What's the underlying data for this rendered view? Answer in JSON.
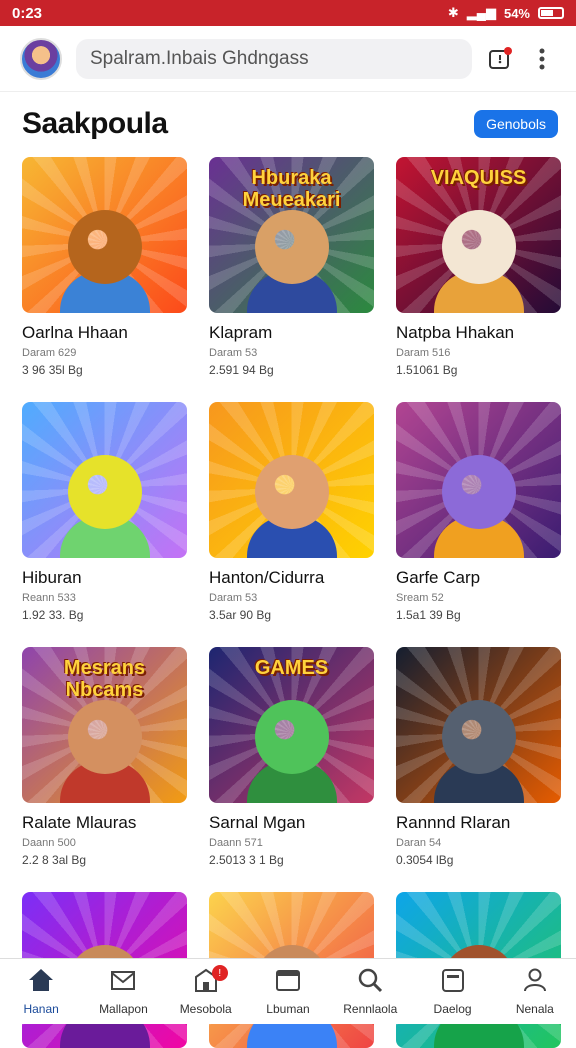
{
  "status": {
    "time": "0:23",
    "battery": "54%"
  },
  "header": {
    "search_placeholder": "Spalram.Inbais Ghdngass"
  },
  "section": {
    "title": "Saakpoula",
    "action_label": "Genobols"
  },
  "games": [
    {
      "name": "Oarlna Hhaan",
      "meta": "Daram 629",
      "size": "3 96 35l Bg",
      "banner": "",
      "colors": [
        "#f7b733",
        "#fc4a1a"
      ],
      "char": "#b5651d",
      "body": "#3b82d6"
    },
    {
      "name": "Klapram",
      "meta": "Daram 53",
      "size": "2.591 94 Bg",
      "banner": "Hburaka Meueakari",
      "colors": [
        "#6a3093",
        "#2b8a3e"
      ],
      "char": "#d9a066",
      "body": "#2e4a9e"
    },
    {
      "name": "Natpba Hhakan",
      "meta": "Daram 516",
      "size": "1.51061 Bg",
      "banner": "VIAQUISS",
      "colors": [
        "#c31432",
        "#240b36"
      ],
      "char": "#f3e6d3",
      "body": "#e8a23a"
    },
    {
      "name": "Hiburan",
      "meta": "Reann 533",
      "size": "1.92 33. Bg",
      "banner": "",
      "colors": [
        "#4facfe",
        "#c471f5"
      ],
      "char": "#e6e22a",
      "body": "#6fd36f"
    },
    {
      "name": "Hanton/Cidurra",
      "meta": "Daram 53",
      "size": "3.5ar 90 Bg",
      "banner": "",
      "colors": [
        "#f7971e",
        "#ffd200"
      ],
      "char": "#e0a070",
      "body": "#2a4fb0"
    },
    {
      "name": "Garfe Carp",
      "meta": "Sream 52",
      "size": "1.5a1 39 Bg",
      "banner": "",
      "colors": [
        "#b24592",
        "#3a1c71"
      ],
      "char": "#8c6ad8",
      "body": "#f0a020"
    },
    {
      "name": "Ralate Mlauras",
      "meta": "Daann 500",
      "size": "2.2 8 3al Bg",
      "banner": "Mesrans Nbcams",
      "colors": [
        "#8e44ad",
        "#f39c12"
      ],
      "char": "#d49060",
      "body": "#c0392b"
    },
    {
      "name": "Sarnal Mgan",
      "meta": "Daann 571",
      "size": "2.5013 3 1 Bg",
      "banner": "GAMES",
      "colors": [
        "#1d2671",
        "#c33764"
      ],
      "char": "#4fc35a",
      "body": "#2f8f3e"
    },
    {
      "name": "Rannnd Rlaran",
      "meta": "Daran 54",
      "size": "0.3054 lBg",
      "banner": "",
      "colors": [
        "#141e30",
        "#e65c00"
      ],
      "char": "#556070",
      "body": "#2a3a55"
    },
    {
      "name": "",
      "meta": "",
      "size": "",
      "banner": "",
      "colors": [
        "#7b2ff7",
        "#f107a3"
      ],
      "char": "#c88a5a",
      "body": "#6a1b9a"
    },
    {
      "name": "",
      "meta": "",
      "size": "",
      "banner": "",
      "colors": [
        "#fcd34d",
        "#ef4444"
      ],
      "char": "#c98a5b",
      "body": "#3b82f6"
    },
    {
      "name": "",
      "meta": "",
      "size": "",
      "banner": "",
      "colors": [
        "#0ea5e9",
        "#22c55e"
      ],
      "char": "#a0522d",
      "body": "#16a34a"
    }
  ],
  "nav": [
    {
      "label": "Hanan",
      "icon": "home-icon",
      "active": true
    },
    {
      "label": "Mallapon",
      "icon": "mail-icon"
    },
    {
      "label": "Mesobola",
      "icon": "store-icon",
      "badge": "!"
    },
    {
      "label": "Lbuman",
      "icon": "window-icon"
    },
    {
      "label": "Rennlaola",
      "icon": "search-icon"
    },
    {
      "label": "Daelog",
      "icon": "tablet-icon"
    },
    {
      "label": "Nenala",
      "icon": "person-icon"
    }
  ]
}
